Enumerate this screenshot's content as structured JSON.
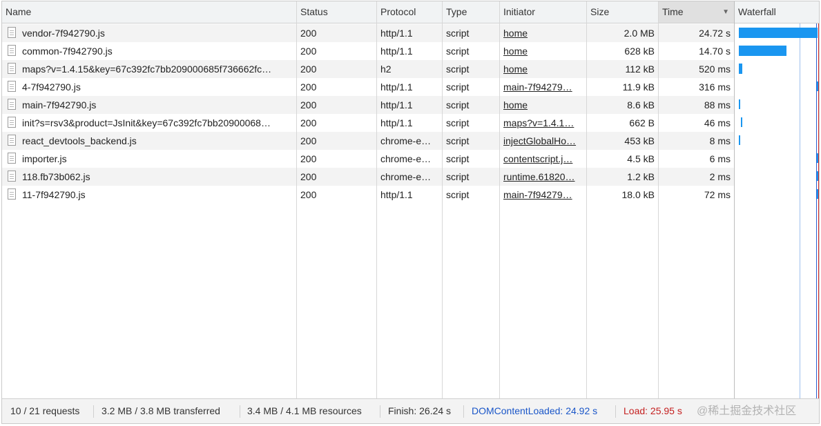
{
  "columns": {
    "name": "Name",
    "status": "Status",
    "protocol": "Protocol",
    "type": "Type",
    "initiator": "Initiator",
    "size": "Size",
    "time": "Time",
    "waterfall": "Waterfall"
  },
  "sort_indicator": "▼",
  "rows": [
    {
      "name": "vendor-7f942790.js",
      "status": "200",
      "protocol": "http/1.1",
      "type": "script",
      "initiator": "home",
      "size": "2.0 MB",
      "time": "24.72 s"
    },
    {
      "name": "common-7f942790.js",
      "status": "200",
      "protocol": "http/1.1",
      "type": "script",
      "initiator": "home",
      "size": "628 kB",
      "time": "14.70 s"
    },
    {
      "name": "maps?v=1.4.15&key=67c392fc7bb209000685f736662fc…",
      "status": "200",
      "protocol": "h2",
      "type": "script",
      "initiator": "home",
      "size": "112 kB",
      "time": "520 ms"
    },
    {
      "name": "4-7f942790.js",
      "status": "200",
      "protocol": "http/1.1",
      "type": "script",
      "initiator": "main-7f94279…",
      "size": "11.9 kB",
      "time": "316 ms"
    },
    {
      "name": "main-7f942790.js",
      "status": "200",
      "protocol": "http/1.1",
      "type": "script",
      "initiator": "home",
      "size": "8.6 kB",
      "time": "88 ms"
    },
    {
      "name": "init?s=rsv3&product=JsInit&key=67c392fc7bb20900068…",
      "status": "200",
      "protocol": "http/1.1",
      "type": "script",
      "initiator": "maps?v=1.4.1…",
      "size": "662 B",
      "time": "46 ms"
    },
    {
      "name": "react_devtools_backend.js",
      "status": "200",
      "protocol": "chrome-e…",
      "type": "script",
      "initiator": "injectGlobalHo…",
      "size": "453 kB",
      "time": "8 ms"
    },
    {
      "name": "importer.js",
      "status": "200",
      "protocol": "chrome-e…",
      "type": "script",
      "initiator": "contentscript.j…",
      "size": "4.5 kB",
      "time": "6 ms"
    },
    {
      "name": "118.fb73b062.js",
      "status": "200",
      "protocol": "chrome-e…",
      "type": "script",
      "initiator": "runtime.61820…",
      "size": "1.2 kB",
      "time": "2 ms"
    },
    {
      "name": "11-7f942790.js",
      "status": "200",
      "protocol": "http/1.1",
      "type": "script",
      "initiator": "main-7f94279…",
      "size": "18.0 kB",
      "time": "72 ms"
    }
  ],
  "status_bar": {
    "requests": "10 / 21 requests",
    "transferred": "3.2 MB / 3.8 MB transferred",
    "resources": "3.4 MB / 4.1 MB resources",
    "finish": "Finish: 26.24 s",
    "dom_content_loaded": "DOMContentLoaded: 24.92 s",
    "load": "Load: 25.95 s"
  },
  "watermark": "@稀土掘金技术社区",
  "colors": {
    "bar": "#1a96f0",
    "dom_content_loaded": "#1a56c8",
    "load": "#c41e1e"
  }
}
